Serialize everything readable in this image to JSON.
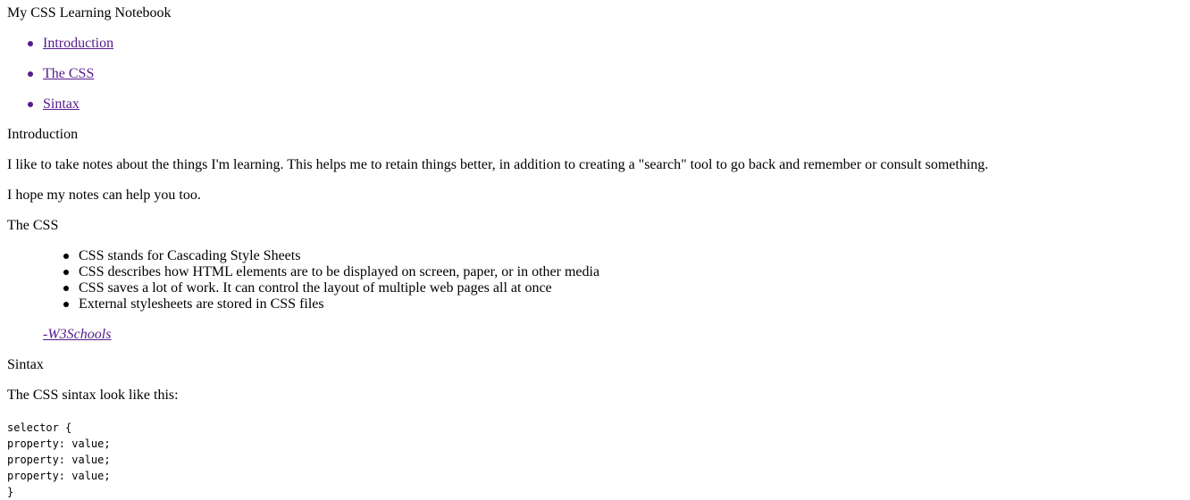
{
  "header": {
    "title": "My CSS Learning Notebook"
  },
  "nav": {
    "items": [
      {
        "label": "Introduction"
      },
      {
        "label": "The CSS"
      },
      {
        "label": "Sintax"
      }
    ]
  },
  "introduction": {
    "heading": "Introduction",
    "paragraph_1": "I like to take notes about the things I'm learning. This helps me to retain things better, in addition to creating a \"search\" tool to go back and remember or consult something.",
    "paragraph_2": "I hope my notes can help you too."
  },
  "the_css": {
    "heading": "The CSS",
    "quote_items": [
      "CSS stands for Cascading Style Sheets",
      "CSS describes how HTML elements are to be displayed on screen, paper, or in other media",
      "CSS saves a lot of work. It can control the layout of multiple web pages all at once",
      "External stylesheets are stored in CSS files"
    ],
    "cite": "-W3Schools"
  },
  "sintax": {
    "heading": "Sintax",
    "paragraph": "The CSS sintax look like this:",
    "code_lines": [
      "selector {",
      "property: value;",
      "property: value;",
      "property: value;",
      "}"
    ]
  },
  "colors": {
    "link": "#551a8b",
    "text": "#000000",
    "background": "#ffffff"
  }
}
